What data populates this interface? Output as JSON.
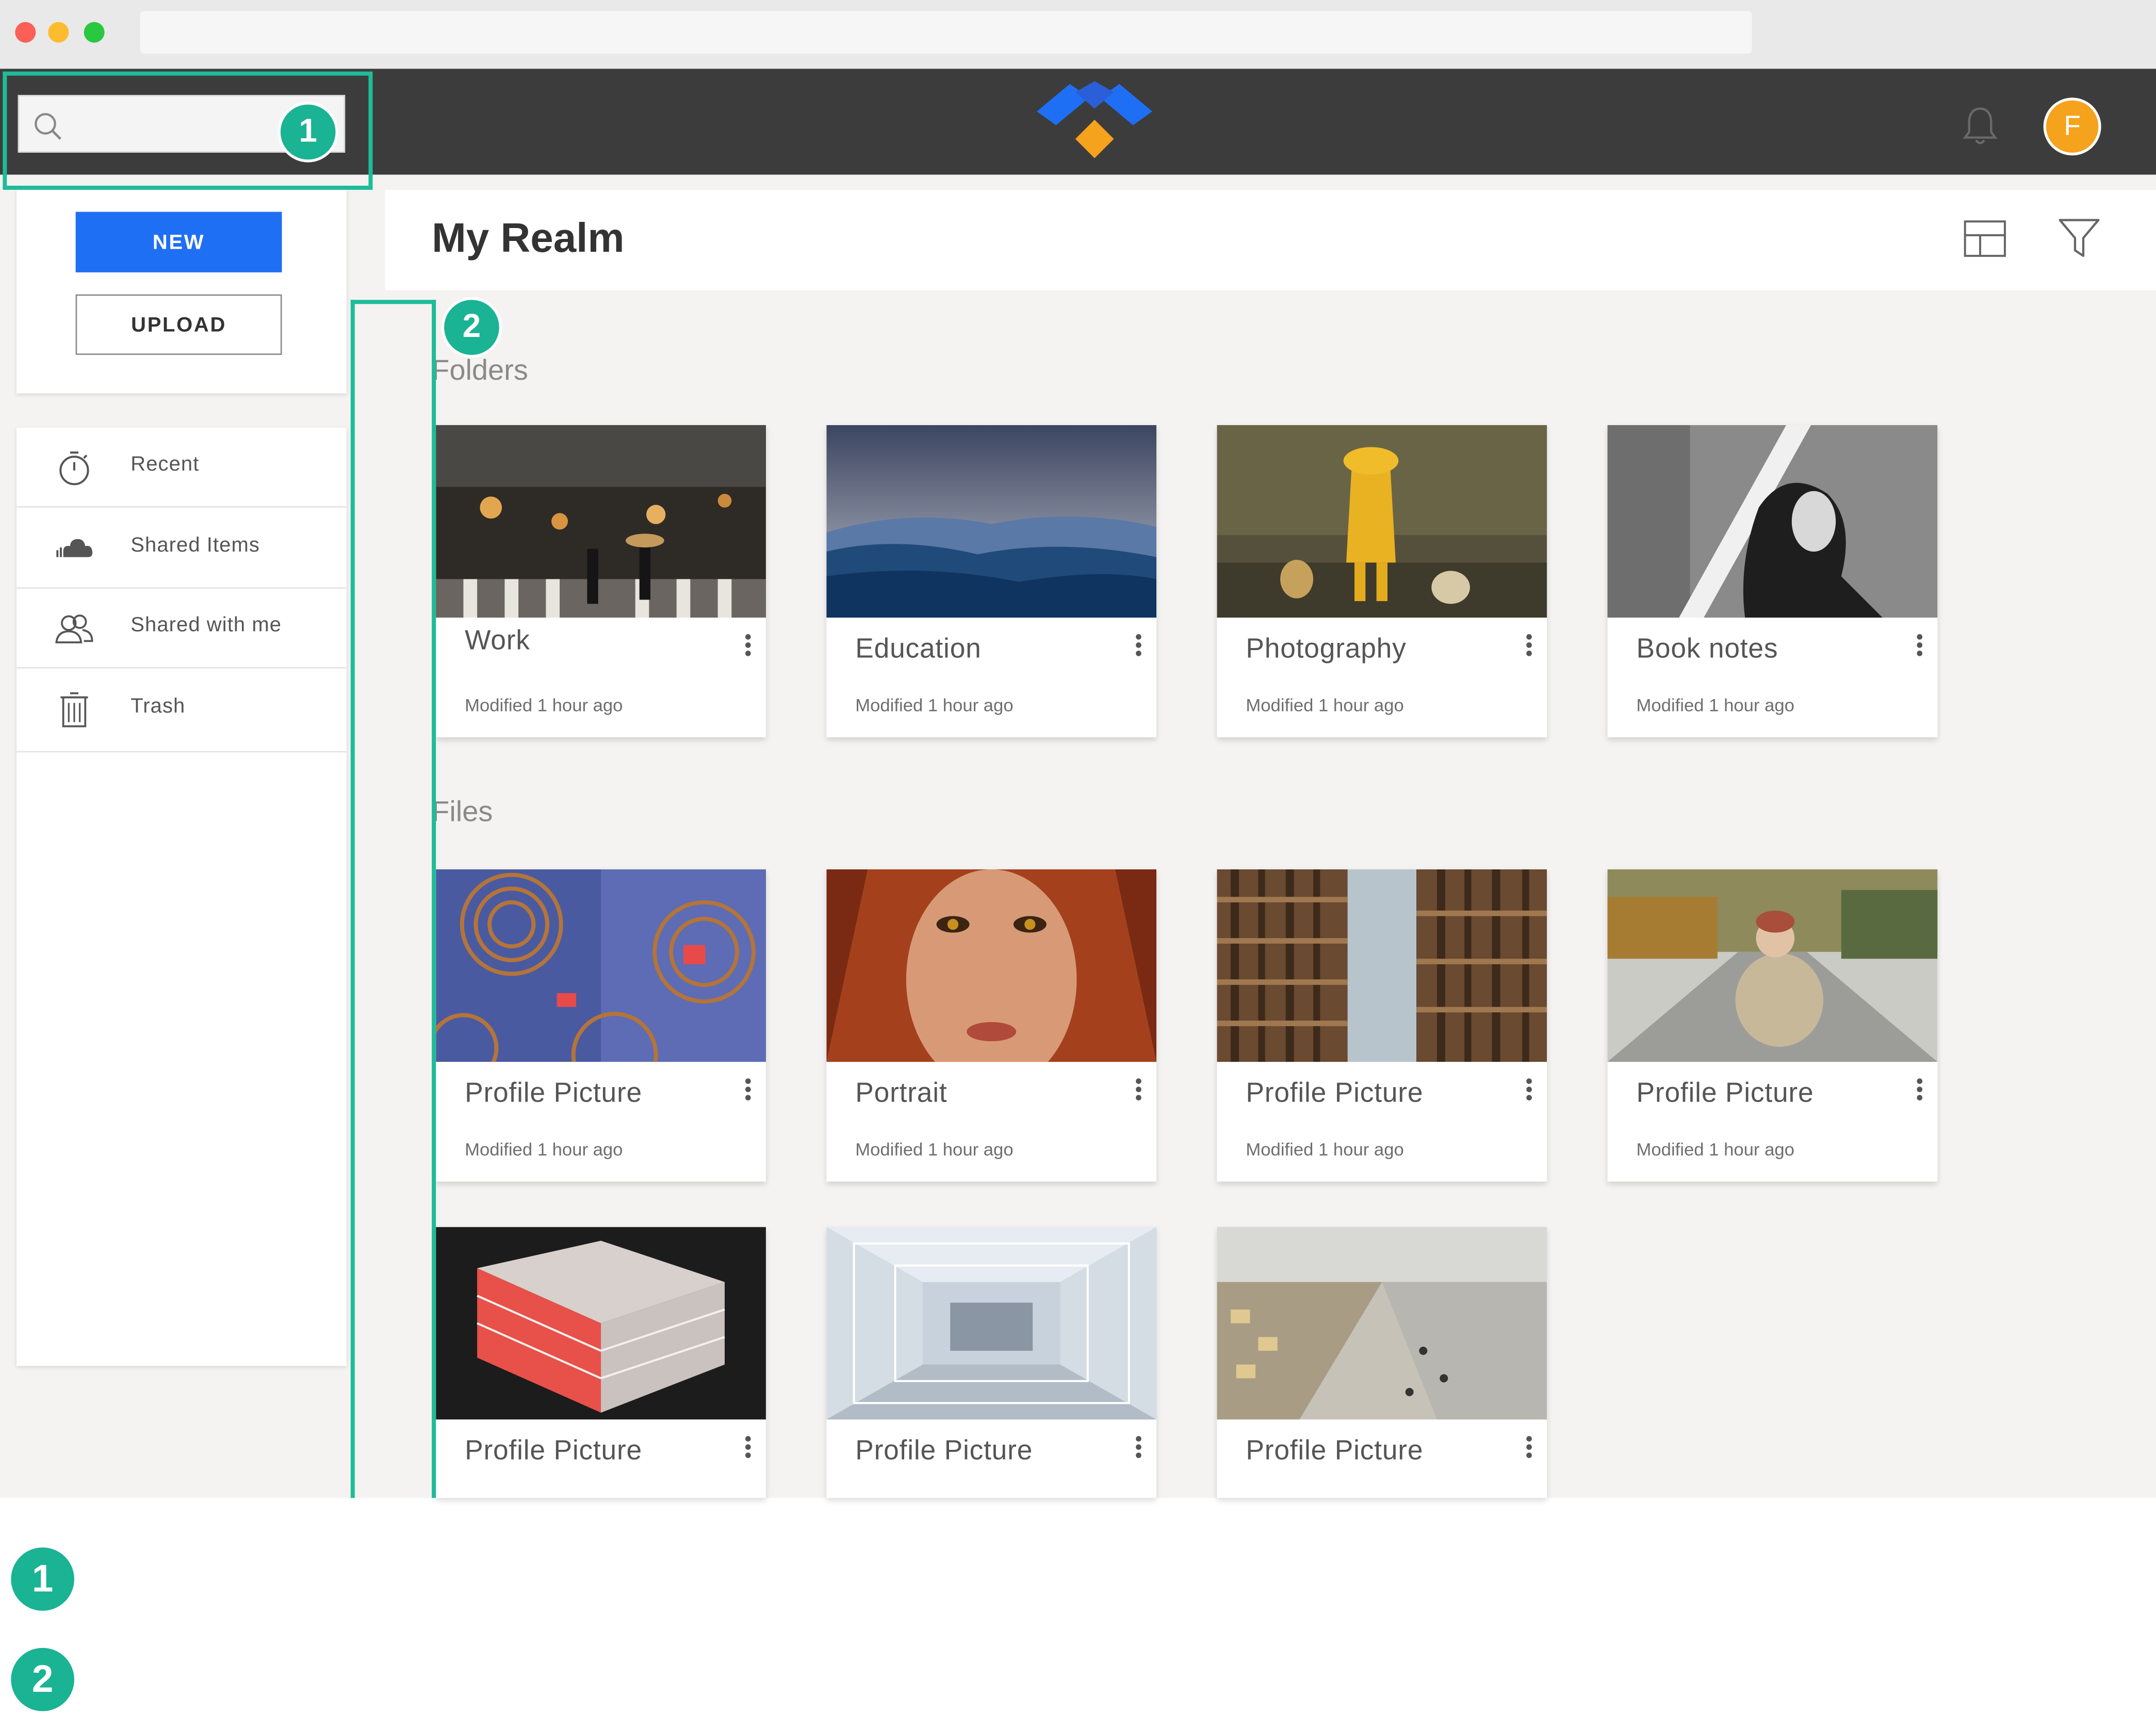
{
  "header": {
    "search_placeholder": "",
    "avatar_initial": "F"
  },
  "sidebar": {
    "new_label": "NEW",
    "upload_label": "UPLOAD",
    "items": [
      {
        "label": "Recent",
        "icon": "stopwatch-icon"
      },
      {
        "label": "Shared Items",
        "icon": "cloud-icon"
      },
      {
        "label": "Shared with me",
        "icon": "users-icon"
      },
      {
        "label": "Trash",
        "icon": "trash-icon"
      }
    ]
  },
  "main": {
    "title": "My Realm",
    "folders_label": "Folders",
    "files_label": "Files",
    "folders": [
      {
        "name": "Work",
        "meta": "Modified 1 hour ago",
        "thumb": "rainy-city-street"
      },
      {
        "name": "Education",
        "meta": "Modified 1 hour ago",
        "thumb": "blue-mountains"
      },
      {
        "name": "Photography",
        "meta": "Modified 1 hour ago",
        "thumb": "child-with-ducks"
      },
      {
        "name": "Book notes",
        "meta": "Modified 1 hour ago",
        "thumb": "woman-in-light"
      }
    ],
    "files": [
      {
        "name": "Profile Picture",
        "meta": "Modified 1 hour ago",
        "thumb": "abstract-circles"
      },
      {
        "name": "Portrait",
        "meta": "Modified 1 hour ago",
        "thumb": "redhead-portrait"
      },
      {
        "name": "Profile Picture",
        "meta": "Modified 1 hour ago",
        "thumb": "wooden-architecture"
      },
      {
        "name": "Profile Picture",
        "meta": "Modified 1 hour ago",
        "thumb": "woman-on-road"
      },
      {
        "name": "Profile Picture",
        "meta": "",
        "thumb": "red-acrylic-model"
      },
      {
        "name": "Profile Picture",
        "meta": "",
        "thumb": "white-corridor"
      },
      {
        "name": "Profile Picture",
        "meta": "",
        "thumb": "atrium-interior"
      }
    ]
  },
  "annotations": {
    "badge_1": "1",
    "badge_2": "2",
    "legend_1": "1",
    "legend_2": "2",
    "accent_color": "#1ebc98"
  },
  "colors": {
    "header": "#3c3c3c",
    "primary_button": "#1f6ff4",
    "avatar": "#f5a21c",
    "logo_blue": "#1f6ff4",
    "logo_orange": "#f5a21c"
  }
}
